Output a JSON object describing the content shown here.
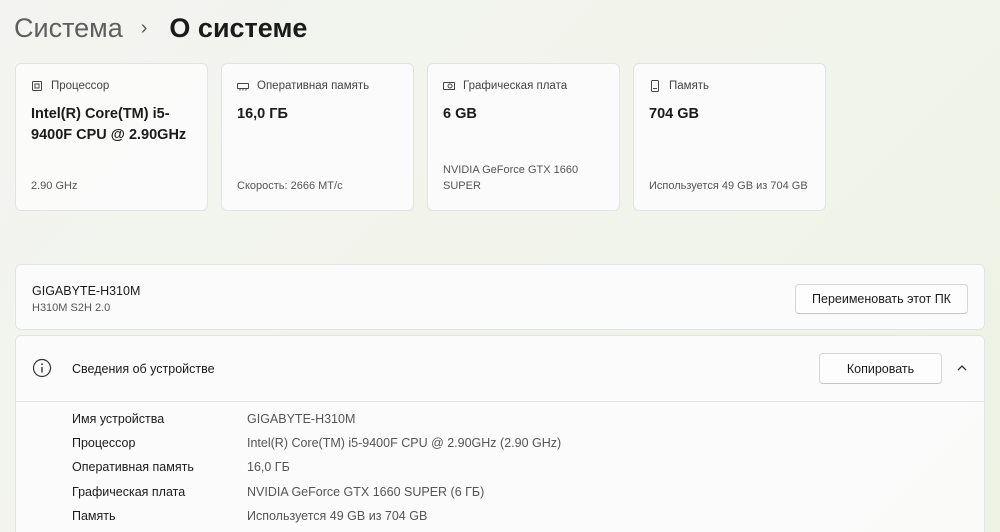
{
  "breadcrumb": {
    "parent": "Система",
    "separator": "›",
    "current": "О системе"
  },
  "cards": [
    {
      "icon": "cpu-icon",
      "label": "Процессор",
      "value": "Intel(R) Core(TM) i5-9400F CPU @ 2.90GHz",
      "sub": "2.90 GHz"
    },
    {
      "icon": "memory-icon",
      "label": "Оперативная память",
      "value": "16,0 ГБ",
      "sub": "Скорость: 2666 МТ/с"
    },
    {
      "icon": "gpu-icon",
      "label": "Графическая плата",
      "value": "6 GB",
      "sub": "NVIDIA GeForce GTX 1660 SUPER"
    },
    {
      "icon": "storage-icon",
      "label": "Память",
      "value": "704 GB",
      "sub": "Используется 49 GB из 704 GB"
    }
  ],
  "device": {
    "name": "GIGABYTE-H310M",
    "model": "H310M S2H 2.0",
    "rename_label": "Переименовать этот ПК"
  },
  "specs": {
    "title": "Сведения об устройстве",
    "copy_label": "Копировать",
    "rows": [
      {
        "label": "Имя устройства",
        "value": "GIGABYTE-H310M"
      },
      {
        "label": "Процессор",
        "value": "Intel(R) Core(TM) i5-9400F CPU @ 2.90GHz (2.90 GHz)"
      },
      {
        "label": "Оперативная память",
        "value": "16,0 ГБ"
      },
      {
        "label": "Графическая плата",
        "value": "NVIDIA GeForce GTX 1660 SUPER (6 ГБ)"
      },
      {
        "label": "Память",
        "value": "Используется 49 GB из 704 GB"
      }
    ]
  }
}
